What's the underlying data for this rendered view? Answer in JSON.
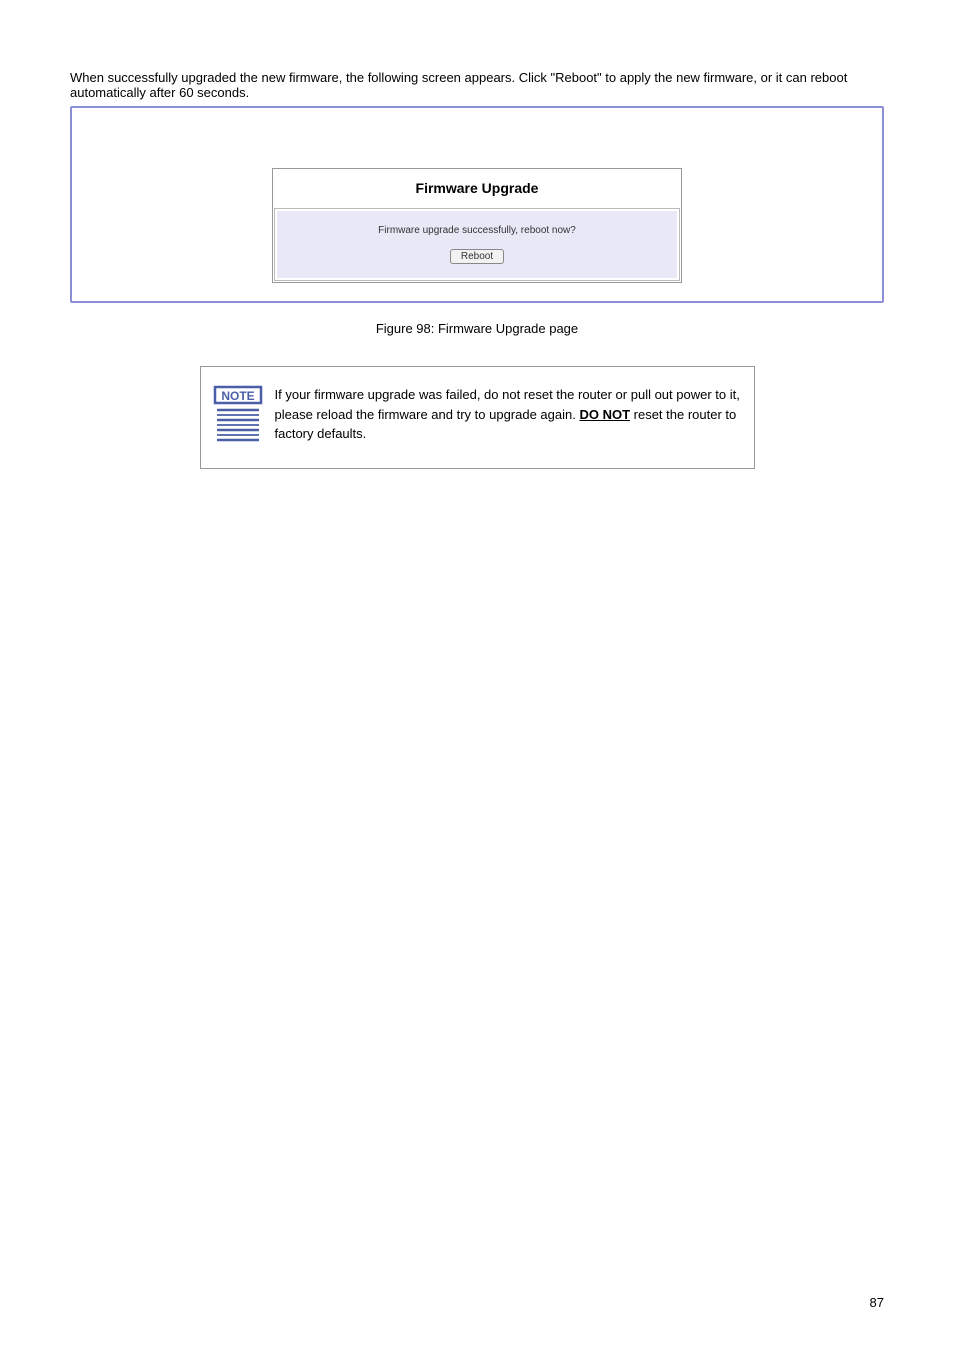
{
  "header": "When successfully upgraded the new firmware, the following screen appears. Click \"Reboot\" to apply the new firmware, or it can reboot automatically after 60 seconds.",
  "dialog": {
    "title": "Firmware Upgrade",
    "message": "Firmware upgrade successfully, reboot now?",
    "button_label": "Reboot"
  },
  "figure_caption": "Figure 98: Firmware Upgrade page",
  "note": {
    "part1": "If your firmware upgrade was failed, do not reset the router or pull out power to it, please reload the firmware and try to upgrade again. ",
    "part2_bold": "DO NOT",
    "part3": " reset the router to factory defaults."
  },
  "page_number": "87"
}
